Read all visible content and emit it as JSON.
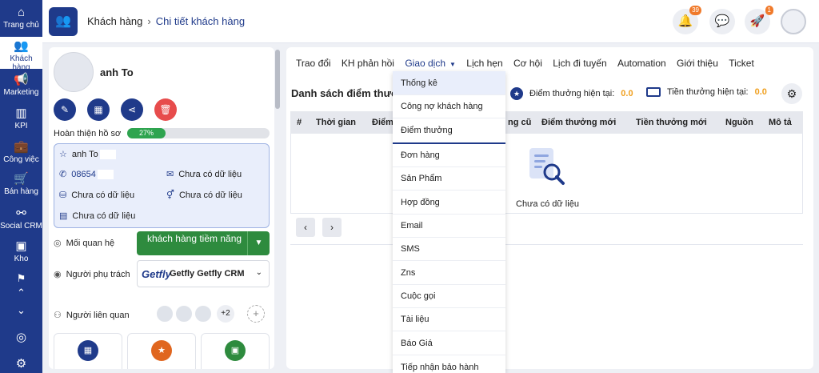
{
  "rail": [
    {
      "label": "Trang chủ",
      "icon": "home-icon",
      "glyph": "⌂"
    },
    {
      "label": "Khách hàng",
      "icon": "users-icon",
      "glyph": "👥"
    },
    {
      "label": "Marketing",
      "icon": "megaphone-icon",
      "glyph": "📢"
    },
    {
      "label": "KPI",
      "icon": "chart-icon",
      "glyph": "▥"
    },
    {
      "label": "Công việc",
      "icon": "briefcase-icon",
      "glyph": "💼"
    },
    {
      "label": "Bán hàng",
      "icon": "cart-icon",
      "glyph": "🛒"
    },
    {
      "label": "Social CRM",
      "icon": "share-icon",
      "glyph": "⚯"
    },
    {
      "label": "Kho",
      "icon": "box-icon",
      "glyph": "▣"
    }
  ],
  "header": {
    "breadcrumb_1": "Khách hàng",
    "breadcrumb_sep": "›",
    "breadcrumb_2": "Chi tiết khách hàng",
    "notif_count": "39",
    "rocket_count": "1"
  },
  "profile": {
    "name": "anh To",
    "completion_label": "Hoàn thiện hồ sơ",
    "completion_text": "27%",
    "completion_value": 27,
    "info_name": "anh To",
    "info_phone": "08654",
    "info_email": "Chưa có dữ liệu",
    "info_birthday": "Chưa có dữ liệu",
    "info_gender": "Chưa có dữ liệu",
    "info_note": "Chưa có dữ liệu",
    "relationship_label": "Mối quan hệ",
    "relationship_value": "khách hàng tiềm năng",
    "owner_label": "Người phụ trách",
    "owner_logo": "Getfly",
    "owner_value": "Getfly Getfly CRM",
    "related_label": "Người liên quan",
    "related_extra": "+2"
  },
  "tabs": [
    "Trao đổi",
    "KH phản hồi",
    "Giao dịch",
    "Lịch hẹn",
    "Cơ hội",
    "Lịch đi tuyến",
    "Automation",
    "Giới thiệu",
    "Ticket"
  ],
  "main": {
    "section_title": "Danh sách điểm thưởng",
    "points_label": "Điểm thưởng hiện tại:",
    "points_value": "0.0",
    "money_label": "Tiền thưởng hiện tại:",
    "money_value": "0.0",
    "columns": [
      "#",
      "Thời gian",
      "Điểm",
      "ng cũ",
      "Điểm thưởng mới",
      "Tiền thưởng mới",
      "Nguồn",
      "Mô tả"
    ],
    "empty_text": "Chưa có dữ liệu",
    "prev": "‹",
    "next": "›"
  },
  "dropdown": [
    "Thống kê",
    "Công nợ khách hàng",
    "Điểm thưởng",
    "Đơn hàng",
    "Sản Phẩm",
    "Hợp đồng",
    "Email",
    "SMS",
    "Zns",
    "Cuộc gọi",
    "Tài liệu",
    "Báo Giá",
    "Tiếp nhận bảo hành"
  ],
  "colors": {
    "primary": "#1f3a8a",
    "green": "#2e8b3e",
    "orange": "#f07a2b",
    "red": "#e74c4c"
  }
}
